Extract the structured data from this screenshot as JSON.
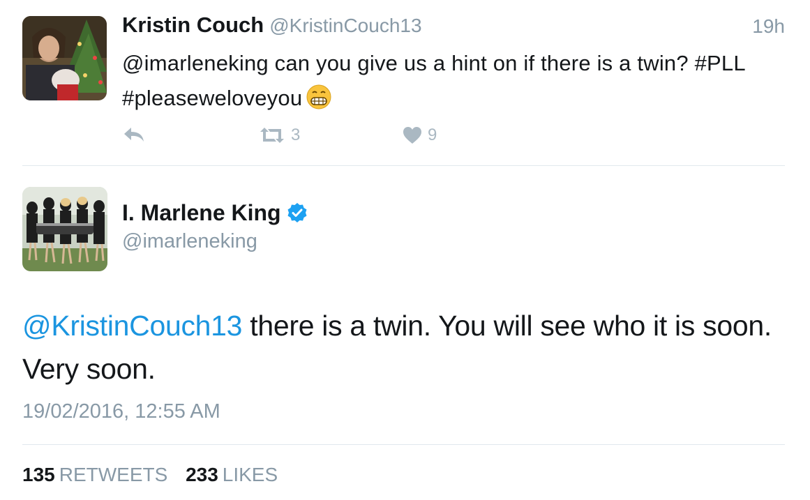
{
  "reply_tweet": {
    "display_name": "Kristin Couch",
    "handle": "@KristinCouch13",
    "time_ago": "19h",
    "text": "@imarleneking can you give us a hint on if there is a twin? #PLL #pleaseweloveyou",
    "emoji": "grimacing-face",
    "retweet_count": "3",
    "like_count": "9"
  },
  "main_tweet": {
    "display_name": "I. Marlene King",
    "verified": true,
    "handle": "@imarleneking",
    "mention": "@KristinCouch13",
    "text": " there is a twin.  You will see who it is soon. Very soon.",
    "timestamp": "19/02/2016, 12:55 AM",
    "retweets_count": "135",
    "retweets_label": "RETWEETS",
    "likes_count": "233",
    "likes_label": "LIKES"
  },
  "colors": {
    "link": "#1b95e0",
    "secondary_text": "#8899a6",
    "action_icon": "#aab8c2",
    "verified_badge": "#1da1f2",
    "divider": "#e1e8ed"
  },
  "icons": {
    "reply": "reply-arrow-icon",
    "retweet": "retweet-icon",
    "like": "heart-icon",
    "verified": "verified-badge-icon"
  }
}
